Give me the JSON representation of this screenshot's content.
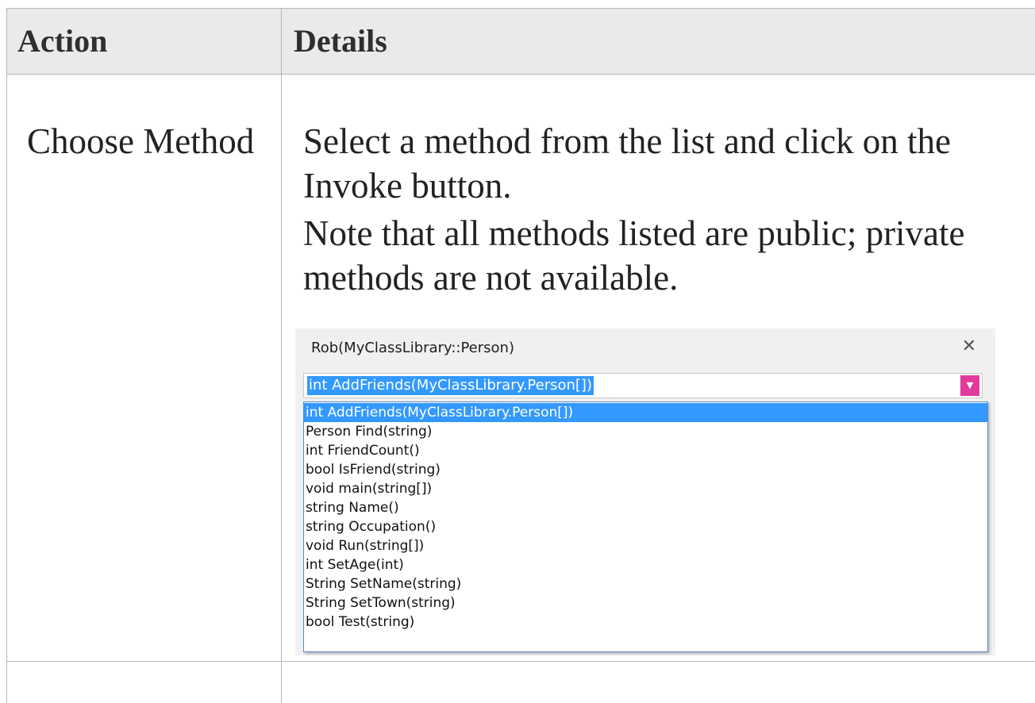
{
  "table": {
    "headers": {
      "action": "Action",
      "details": "Details"
    },
    "row": {
      "action": "Choose Method",
      "details_paragraph_1": "Select a method from the list and click on the Invoke button.",
      "details_paragraph_2": "Note that all methods listed are public; private methods are not available."
    }
  },
  "dialog": {
    "title": "Rob(MyClassLibrary::Person)",
    "close_glyph": "✕",
    "combo_value": "int AddFriends(MyClassLibrary.Person[])",
    "combo_button_glyph": "▼",
    "combo_button_color": "#e13a9d",
    "selection_color": "#3399ff",
    "selected_index": 0,
    "methods": [
      "int AddFriends(MyClassLibrary.Person[])",
      "Person Find(string)",
      "int FriendCount()",
      "bool IsFriend(string)",
      "void main(string[])",
      "string Name()",
      "string Occupation()",
      "void Run(string[])",
      "int SetAge(int)",
      "String SetName(string)",
      "String SetTown(string)",
      "bool Test(string)"
    ]
  }
}
